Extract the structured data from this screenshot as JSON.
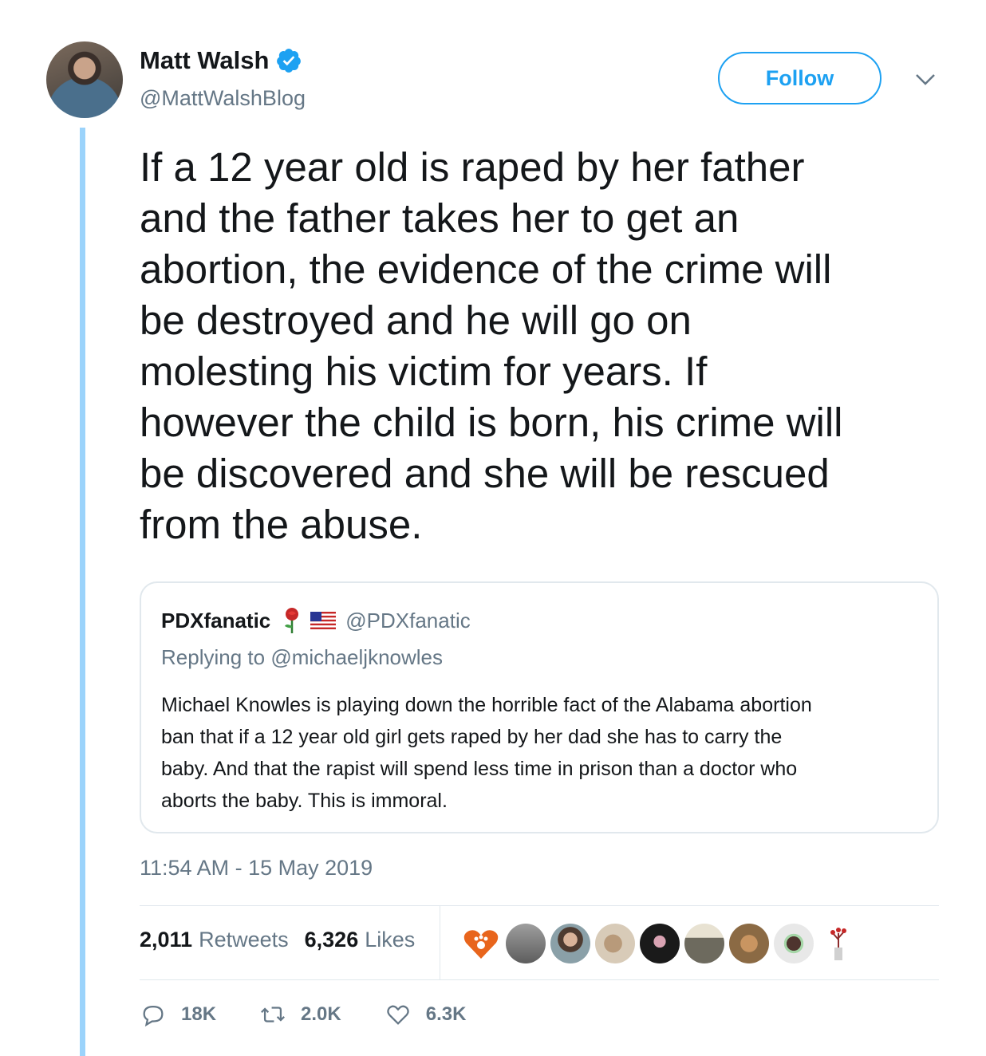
{
  "author": {
    "display_name": "Matt Walsh",
    "handle": "@MattWalshBlog",
    "verified_icon": "verified-badge-icon"
  },
  "follow_label": "Follow",
  "tweet_text": "If a 12 year old is raped by her father\nand the father takes her to get an\nabortion, the evidence of the crime will\nbe destroyed and he will go on\nmolesting his victim for years. If\nhowever the child is born, his crime will\nbe discovered and she will be rescued\nfrom the abuse.",
  "quoted": {
    "display_name": "PDXfanatic",
    "handle": "@PDXfanatic",
    "replying_prefix": "Replying to ",
    "replying_to": "@michaeljknowles",
    "text": "Michael Knowles is playing down the horrible fact of the Alabama abortion\nban that if a 12 year old girl gets raped by her dad she has to carry the\nbaby. And that the rapist will spend less time in prison than a doctor who\naborts the baby. This is immoral."
  },
  "timestamp": "11:54 AM - 15 May 2019",
  "stats": {
    "retweets_count": "2,011",
    "retweets_label": "Retweets",
    "likes_count": "6,326",
    "likes_label": "Likes"
  },
  "liker_avatars_count": 9,
  "actions": {
    "reply_count": "18K",
    "retweet_count": "2.0K",
    "like_count": "6.3K"
  },
  "colors": {
    "accent": "#1da1f2",
    "thread_line": "#9bd3fb",
    "secondary_text": "#657786",
    "border": "#e1e8ed"
  }
}
